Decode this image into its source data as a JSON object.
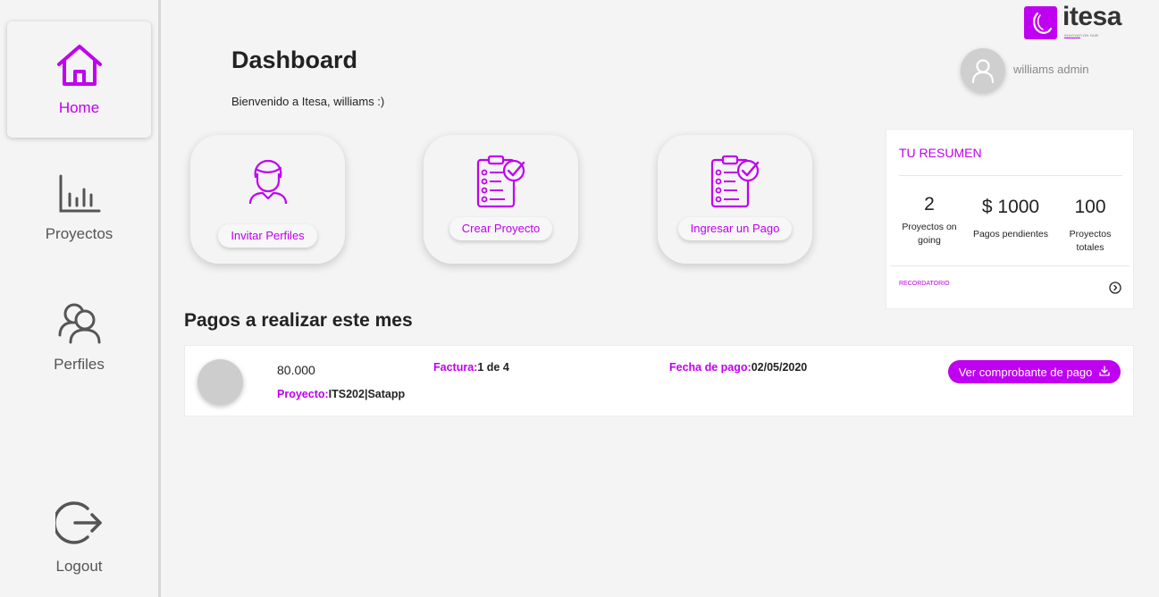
{
  "sidebar": {
    "items": [
      {
        "label": "Home",
        "icon": "home-icon",
        "active": true
      },
      {
        "label": "Proyectos",
        "icon": "bar-chart-icon"
      },
      {
        "label": "Perfiles",
        "icon": "users-icon"
      },
      {
        "label": "Logout",
        "icon": "logout-icon"
      }
    ]
  },
  "brand": {
    "name": "itesa",
    "tagline": "INNOVATION HUB",
    "color": "#c000f0"
  },
  "user": {
    "name": "williams admin"
  },
  "header": {
    "title": "Dashboard",
    "welcome": "Bienvenido a Itesa, williams :)"
  },
  "actions": [
    {
      "label": "Invitar Perfiles",
      "icon": "user-profile-icon"
    },
    {
      "label": "Crear Proyecto",
      "icon": "clipboard-check-icon"
    },
    {
      "label": "Ingresar un Pago",
      "icon": "clipboard-check-icon"
    }
  ],
  "summary": {
    "title": "TU RESUMEN",
    "stats": [
      {
        "value": "2",
        "label": "Proyectos on going"
      },
      {
        "value": "$ 1000",
        "label": "Pagos pendientes"
      },
      {
        "value": "100",
        "label": "Proyectos totales"
      }
    ],
    "reminder": "RECORDATORIO"
  },
  "payments": {
    "title": "Pagos a realizar este mes",
    "rows": [
      {
        "amount": "80.000",
        "project_key": "Proyecto:",
        "project_value": "ITS202|Satapp",
        "invoice_key": "Factura:",
        "invoice_value": "1 de 4",
        "date_key": "Fecha de pago:",
        "date_value": "02/05/2020",
        "button": "Ver comprobante de pago"
      }
    ]
  }
}
